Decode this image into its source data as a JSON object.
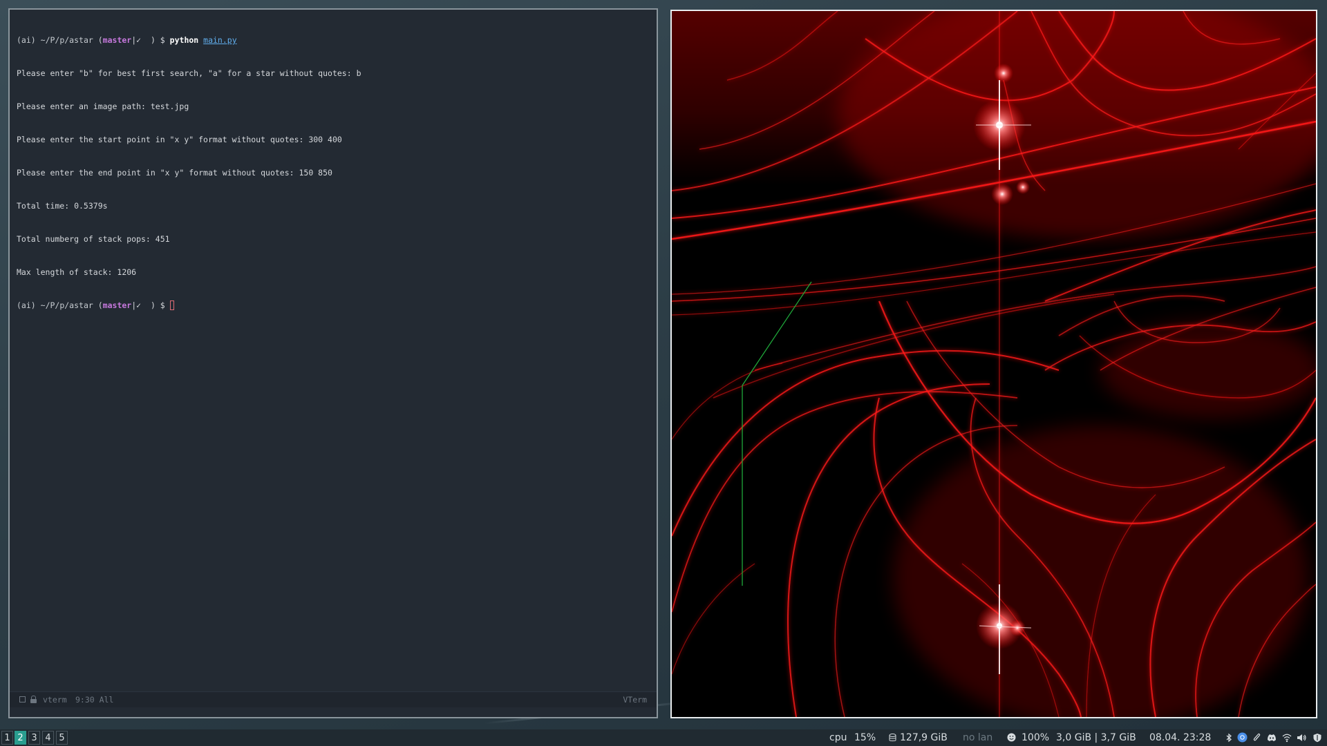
{
  "terminal": {
    "prompt": {
      "env": "(ai)",
      "path": "~/P/p/astar",
      "branch": "master",
      "status": "✓",
      "symbol": "$"
    },
    "command": {
      "program": "python",
      "file": "main.py"
    },
    "output": [
      "Please enter \"b\" for best first search, \"a\" for a star without quotes: b",
      "Please enter an image path: test.jpg",
      "Please enter the start point in \"x y\" format without quotes: 300 400",
      "Please enter the end point in \"x y\" format without quotes: 150 850",
      "Total time: 0.5379s",
      "Total numberg of stack pops: 451",
      "Max length of stack: 1206"
    ],
    "modeline": {
      "buffer": "vterm",
      "position": "9:30 All",
      "mode": "VTerm"
    }
  },
  "viewer": {
    "path_color": "#1fa83a",
    "accent_color": "#ff1a1a"
  },
  "statusbar": {
    "workspaces": [
      "1",
      "2",
      "3",
      "4",
      "5"
    ],
    "active_workspace": "2",
    "cpu_label": "cpu",
    "cpu_value": "15%",
    "disk_icon": "disk-icon",
    "disk_free": "127,9 GiB",
    "lan": "no lan",
    "battery_icon": "smiley-icon",
    "battery": "100%",
    "memory": "3,0 GiB | 3,7 GiB",
    "datetime": "08.04. 23:28",
    "tray_icons": [
      "bluetooth-icon",
      "chromium-icon",
      "paperclip-icon",
      "discord-icon",
      "wifi-icon",
      "volume-icon",
      "shield-icon"
    ],
    "workspace_active_color": "#2a9d8f"
  }
}
